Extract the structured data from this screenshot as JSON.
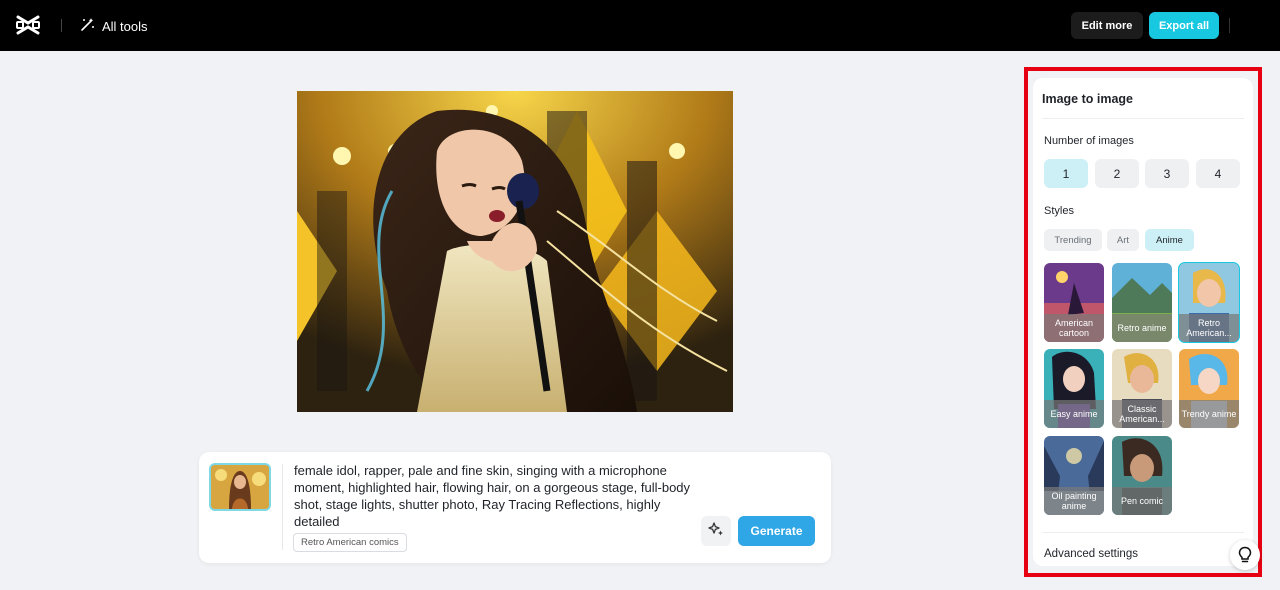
{
  "header": {
    "all_tools_label": "All tools",
    "edit_more_label": "Edit more",
    "export_all_label": "Export all"
  },
  "prompt": {
    "text": "female idol, rapper, pale and fine skin, singing with a microphone moment, highlighted hair, flowing hair, on a gorgeous stage, full-body shot, stage lights, shutter photo, Ray Tracing Reflections, highly detailed",
    "style_tag": "Retro American comics",
    "generate_label": "Generate"
  },
  "panel": {
    "title": "Image to image",
    "number_label": "Number of images",
    "numbers": [
      "1",
      "2",
      "3",
      "4"
    ],
    "selected_number": "1",
    "styles_label": "Styles",
    "style_tabs": [
      "Trending",
      "Art",
      "Anime"
    ],
    "active_tab": "Anime",
    "styles": [
      {
        "label": "American cartoon"
      },
      {
        "label": "Retro anime"
      },
      {
        "label": "Retro American..."
      },
      {
        "label": "Easy anime"
      },
      {
        "label": "Classic American..."
      },
      {
        "label": "Trendy anime"
      },
      {
        "label": "Oil painting anime"
      },
      {
        "label": "Pen comic"
      }
    ],
    "selected_style": "Retro American...",
    "advanced_label": "Advanced settings"
  },
  "colors": {
    "accent": "#17c8e0",
    "generate": "#2fa6e6",
    "highlight_frame": "#e60012"
  }
}
